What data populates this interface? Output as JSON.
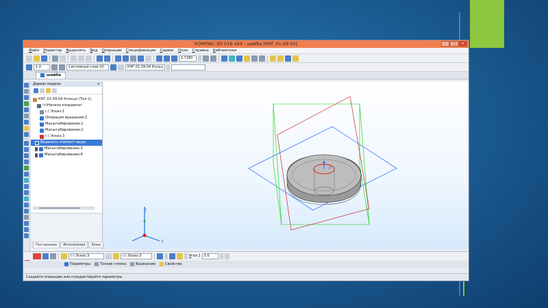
{
  "window": {
    "title": "КОМПАС-3D V16  x64 - шайба [КНГ.01.09.04]"
  },
  "menu": [
    "Файл",
    "Редактор",
    "Выделить",
    "Вид",
    "Операции",
    "Спецификация",
    "Сервис",
    "Окно",
    "Справка",
    "Библиотеки"
  ],
  "toolbar": {
    "zoom_value": "1.7280",
    "scale_value": "1.0",
    "layer_value": "Системный слой (0)",
    "object_value": "КНГ.01.09.04 Кольц"
  },
  "document_tab": {
    "label": "шайба"
  },
  "model_tree": {
    "title": "Дерево модели",
    "close_glyph": "×",
    "items": [
      {
        "label": "КНГ.01.09.04 Кольцо (Тел-1)",
        "icon": "assembly-icon",
        "color": "#c8873a"
      },
      {
        "label": "(т)Начало координат",
        "icon": "origin-icon",
        "color": "#5b6b7d"
      },
      {
        "label": "(-) Эскиз:1",
        "icon": "sketch-icon",
        "color": "#7a8aa0"
      },
      {
        "label": "Операция вращения:2",
        "icon": "rotate-operation-icon",
        "color": "#2f74d0"
      },
      {
        "label": "Масштабирование:1",
        "icon": "scale-icon",
        "color": "#2f74d0"
      },
      {
        "label": "Масштабирование:2",
        "icon": "scale-icon",
        "color": "#2f74d0"
      },
      {
        "label": "(-) Эскиз:3",
        "icon": "sketch-icon",
        "color": "#c0392b"
      },
      {
        "label": "Вырезать элемент выда",
        "icon": "cut-icon",
        "color": "#2f74d0",
        "selected": true
      },
      {
        "label": "Масштабирование:3",
        "icon": "scale-icon",
        "color": "#2f74d0"
      },
      {
        "label": "Масштабирование:4",
        "icon": "scale-icon",
        "color": "#2f74d0"
      }
    ]
  },
  "bottom_tabs": [
    "Построение",
    "Исполнения",
    "Зоны"
  ],
  "properties": {
    "sketch_field_1": "(-) Эскиз:3",
    "sketch_field_2": "(-) Эскиз:3",
    "angle_label_prefix": "",
    "angle_label_underlined": "У",
    "angle_label_rest": "гол 1",
    "angle_value": "0.0"
  },
  "property_tabs": [
    "Параметры",
    "Тонкая стенка",
    "Вырезание",
    "Свойства"
  ],
  "axes": {
    "y": "Y",
    "z": "Z"
  },
  "status": {
    "text": "Создайте операцию или отредактируйте параметры"
  },
  "colors": {
    "titlebar": "#f07e4f",
    "accent": "#8dc63f",
    "desktop": "#1c5f96",
    "selection": "#3b78d8"
  }
}
